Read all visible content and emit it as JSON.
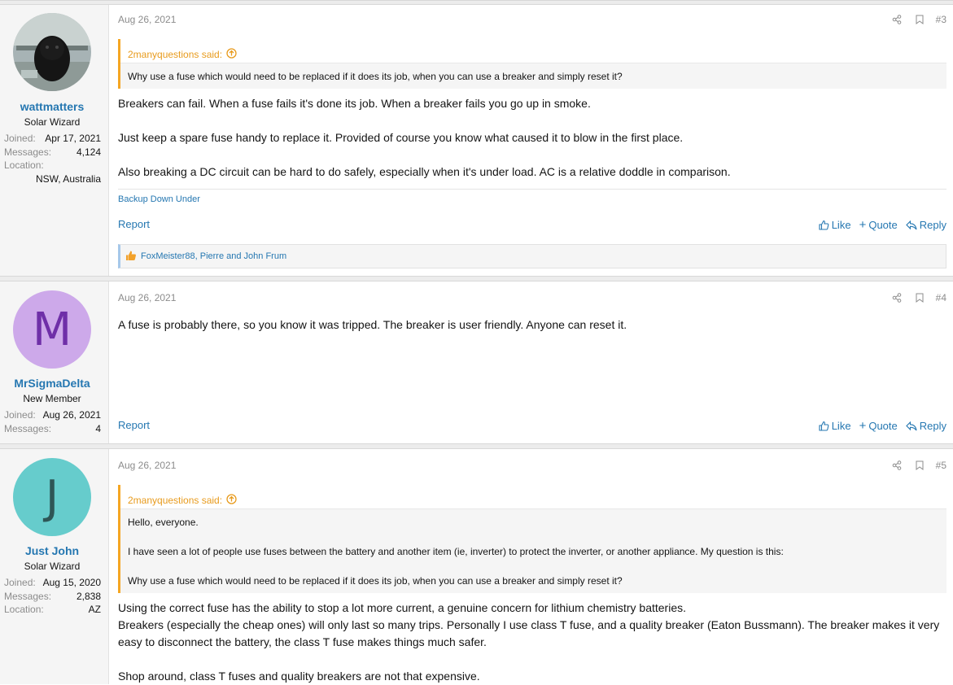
{
  "posts": [
    {
      "user": {
        "name": "wattmatters",
        "title": "Solar Wizard",
        "stats": [
          {
            "k": "Joined:",
            "v": "Apr 17, 2021"
          },
          {
            "k": "Messages:",
            "v": "4,124"
          },
          {
            "k": "Location:",
            "v": ""
          }
        ],
        "location_value": "NSW, Australia"
      },
      "date": "Aug 26, 2021",
      "number": "#3",
      "quote": {
        "author": "2manyquestions said:",
        "lines": [
          "Why use a fuse which would need to be replaced if it does its job, when you can use a breaker and simply reset it?"
        ]
      },
      "body": [
        "Breakers can fail. When a fuse fails it's done its job. When a breaker fails you go up in smoke.",
        "Just keep a spare fuse handy to replace it. Provided of course you know what caused it to blow in the first place.",
        "Also breaking a DC circuit can be hard to do safely, especially when it's under load. AC is a relative doddle in comparison."
      ],
      "signature": "Backup Down Under",
      "reactions": "FoxMeister88, Pierre and John Frum"
    },
    {
      "user": {
        "name": "MrSigmaDelta",
        "title": "New Member",
        "avatar_letter": "M",
        "stats": [
          {
            "k": "Joined:",
            "v": "Aug 26, 2021"
          },
          {
            "k": "Messages:",
            "v": "4"
          }
        ]
      },
      "date": "Aug 26, 2021",
      "number": "#4",
      "body": [
        "A fuse is probably there, so you know it was tripped. The breaker is user friendly. Anyone can reset it."
      ]
    },
    {
      "user": {
        "name": "Just John",
        "title": "Solar Wizard",
        "avatar_letter": "J",
        "stats": [
          {
            "k": "Joined:",
            "v": "Aug 15, 2020"
          },
          {
            "k": "Messages:",
            "v": "2,838"
          },
          {
            "k": "Location:",
            "v": "AZ"
          }
        ]
      },
      "date": "Aug 26, 2021",
      "number": "#5",
      "quote": {
        "author": "2manyquestions said:",
        "lines": [
          "Hello, everyone.",
          "I have seen a lot of people use fuses between the battery and another item (ie, inverter) to protect the inverter, or another appliance. My question is this:",
          "Why use a fuse which would need to be replaced if it does its job, when you can use a breaker and simply reset it?"
        ]
      },
      "body": [
        "Using the correct fuse has the ability to stop a lot more current, a genuine concern for lithium chemistry batteries.",
        "Breakers (especially the cheap ones) will only last so many trips. Personally I use class T fuse, and a quality breaker (Eaton Bussmann). The breaker makes it very easy to disconnect the battery, the class T fuse makes things much safer.",
        "Shop around, class T fuses and quality breakers are not that expensive."
      ]
    }
  ],
  "labels": {
    "report": "Report",
    "like": "Like",
    "quote": "Quote",
    "reply": "Reply"
  },
  "icons": {
    "share": "share-icon",
    "bookmark": "bookmark-icon",
    "like": "thumbs-up-icon",
    "plus": "plus-icon",
    "reply": "reply-icon",
    "quote_up": "arrow-up-circle-icon",
    "reaction": "thumbs-up-reaction-icon"
  },
  "colors": {
    "link": "#2577b1",
    "quote_accent": "#f5a623",
    "avatar_m_bg": "#cda9ea",
    "avatar_m_fg": "#6f2fa8",
    "avatar_j_bg": "#66cccc",
    "avatar_j_fg": "#2e5656"
  }
}
